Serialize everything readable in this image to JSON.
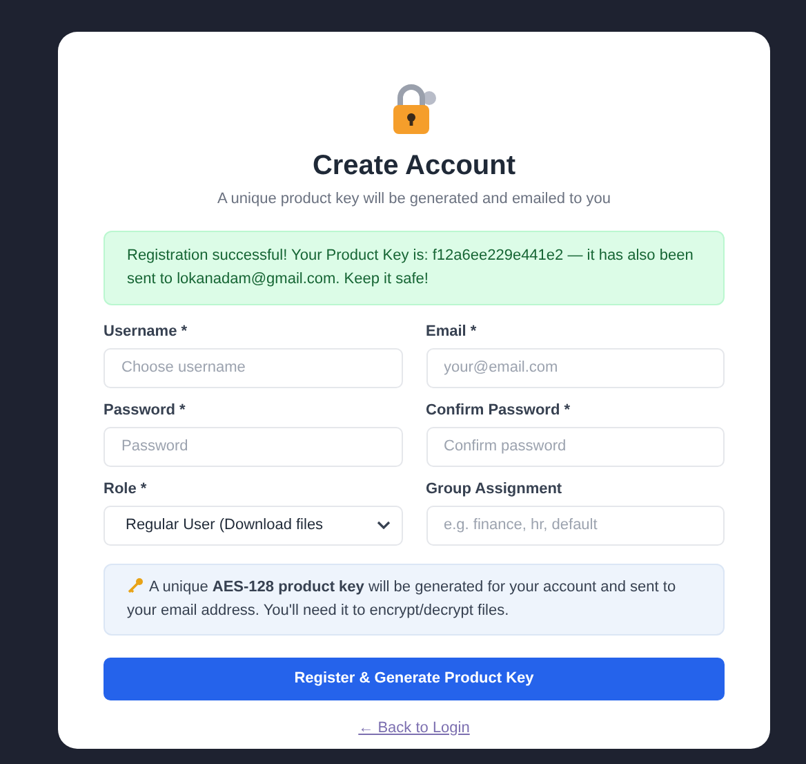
{
  "title": "Create Account",
  "subtitle": "A unique product key will be generated and emailed to you",
  "alert": {
    "kind": "success",
    "text": "Registration successful! Your Product Key is: f12a6ee229e441e2 — it has also been sent to lokanadam@gmail.com. Keep it safe!"
  },
  "fields": [
    {
      "kind": "text",
      "label": "Username *",
      "placeholder": "Choose username"
    },
    {
      "kind": "text",
      "label": "Email *",
      "placeholder": "your@email.com"
    },
    {
      "kind": "text",
      "label": "Password *",
      "placeholder": "Password"
    },
    {
      "kind": "text",
      "label": "Confirm Password *",
      "placeholder": "Confirm password"
    },
    {
      "kind": "select",
      "label": "Role *",
      "value": "Regular User (Download files"
    },
    {
      "kind": "text",
      "label": "Group Assignment",
      "placeholder": "e.g. finance, hr, default"
    }
  ],
  "info": "A unique **AES-128 product key** will be generated for your account and sent to your email address. You'll need it to encrypt/decrypt files.",
  "submit_button": "Register & Generate Product Key",
  "back_link": "← Back to Login"
}
